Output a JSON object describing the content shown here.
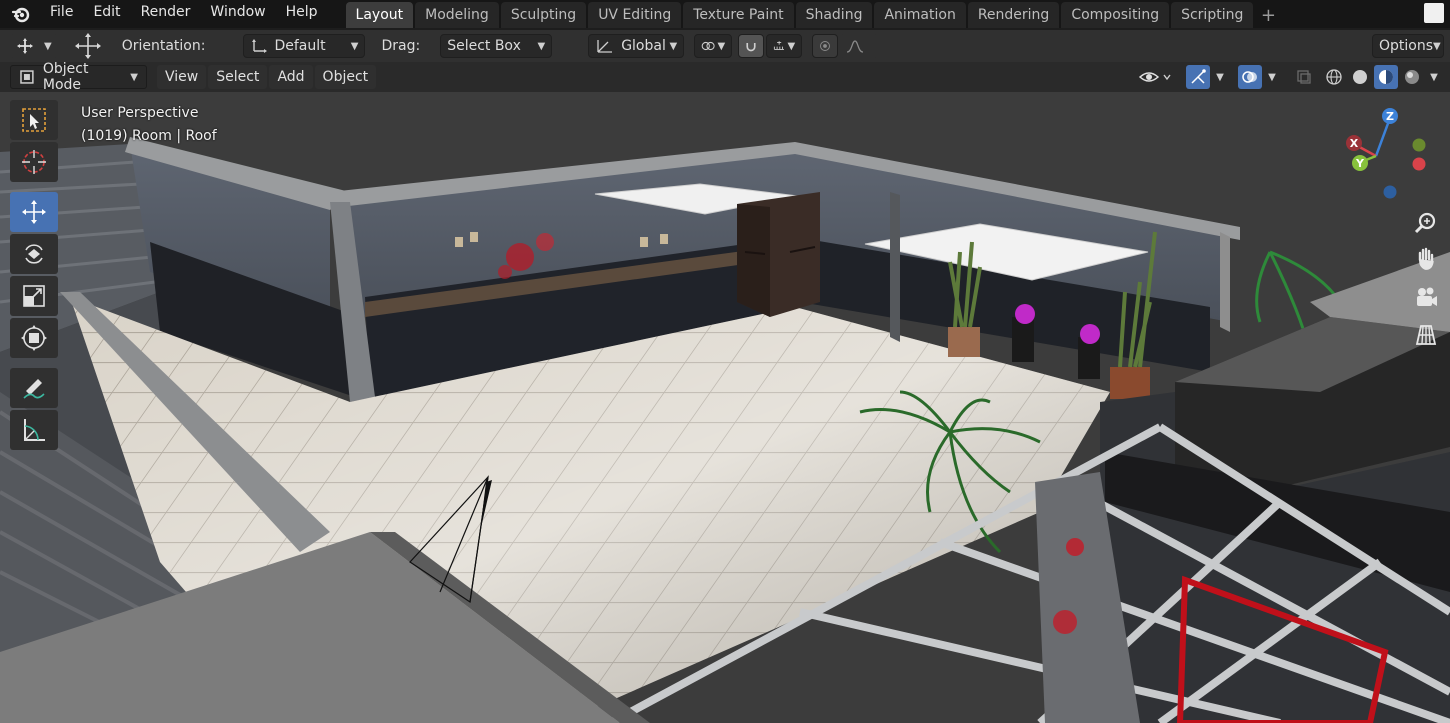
{
  "menu": {
    "items": [
      "File",
      "Edit",
      "Render",
      "Window",
      "Help"
    ]
  },
  "workspaces": {
    "tabs": [
      "Layout",
      "Modeling",
      "Sculpting",
      "UV Editing",
      "Texture Paint",
      "Shading",
      "Animation",
      "Rendering",
      "Compositing",
      "Scripting"
    ],
    "active": "Layout",
    "add_label": "+"
  },
  "toolsettings": {
    "orientation_label": "Orientation:",
    "orientation_value": "Default",
    "drag_label": "Drag:",
    "drag_value": "Select Box",
    "transform_orientation": "Global",
    "options_label": "Options"
  },
  "header": {
    "mode": "Object Mode",
    "menus": [
      "View",
      "Select",
      "Add",
      "Object"
    ]
  },
  "viewport": {
    "perspective_label": "User Perspective",
    "object_info": "(1019) Room | Roof"
  },
  "gizmo": {
    "x": "X",
    "y": "Y",
    "z": "Z"
  },
  "colors": {
    "active_blue": "#4772b3",
    "axis_x": "#d9434a",
    "axis_y": "#88c23c",
    "axis_z": "#3c82d9"
  }
}
